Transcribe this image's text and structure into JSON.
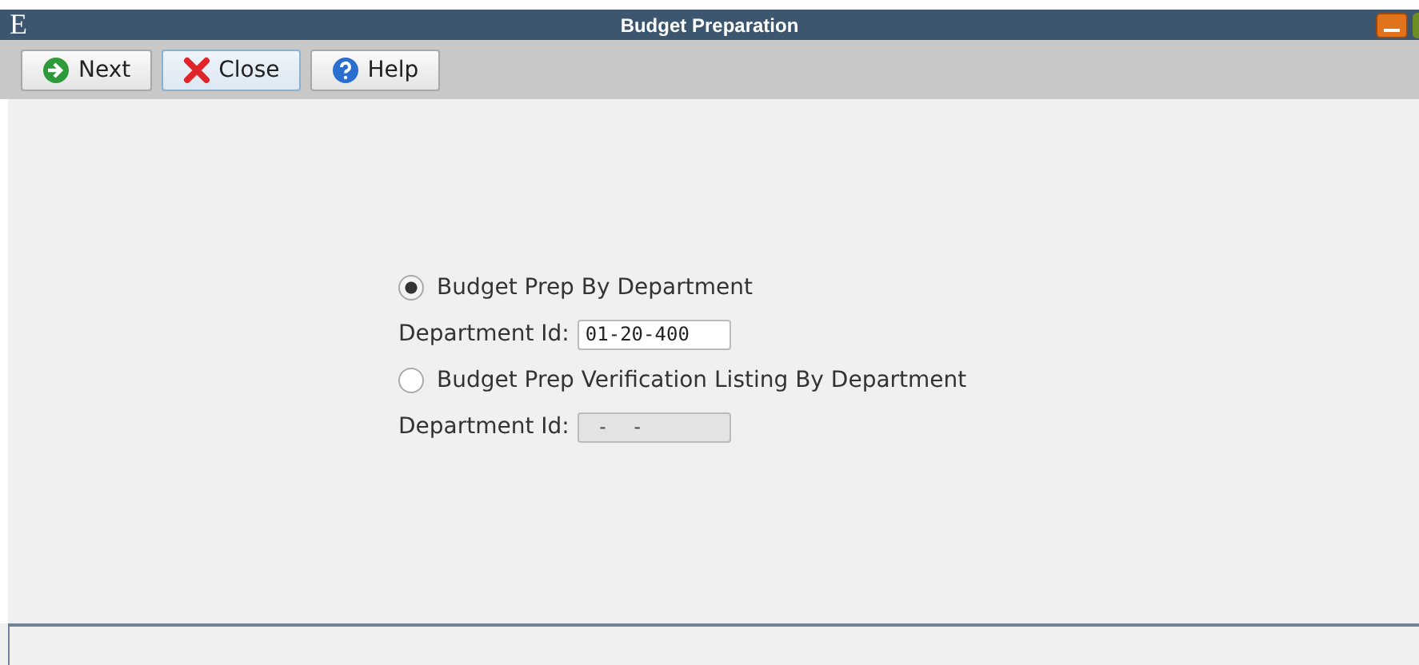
{
  "window": {
    "logo": "E",
    "title": "Budget Preparation"
  },
  "toolbar": [
    {
      "kind": "next",
      "label": "Next",
      "selected": false
    },
    {
      "kind": "close",
      "label": "Close",
      "selected": true
    },
    {
      "kind": "help",
      "label": "Help",
      "selected": false
    }
  ],
  "options": [
    {
      "label": "Budget Prep By Department",
      "selected": true,
      "field_label": "Department Id:",
      "value": "01-20-400",
      "disabled": false
    },
    {
      "label": "Budget Prep Verification Listing By Department",
      "selected": false,
      "field_label": "Department Id:",
      "value": " -  -",
      "disabled": true
    }
  ]
}
